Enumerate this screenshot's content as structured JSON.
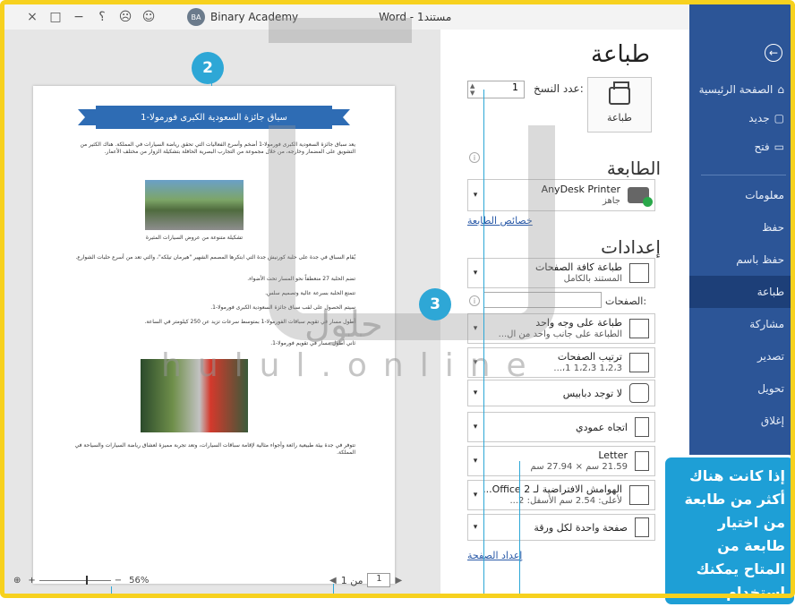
{
  "titlebar": {
    "close": "×",
    "restore": "□",
    "minimize": "−",
    "help": "؟",
    "sad_face": "☹",
    "smile_face": "☺",
    "avatar": "BA",
    "account": "Binary Academy",
    "doc_title": "Word - مستند1"
  },
  "sidebar": {
    "back": "←",
    "items": [
      {
        "label": "الصفحة الرئيسية",
        "icon": "⌂"
      },
      {
        "label": "جديد",
        "icon": "▢"
      },
      {
        "label": "فتح",
        "icon": "▭"
      },
      {
        "label": "معلومات"
      },
      {
        "label": "حفظ"
      },
      {
        "label": "حفظ باسم"
      },
      {
        "label": "طباعة"
      },
      {
        "label": "مشاركة"
      },
      {
        "label": "تصدير"
      },
      {
        "label": "تحويل"
      },
      {
        "label": "إغلاق"
      }
    ]
  },
  "print": {
    "title": "طباعة",
    "copies_label": "عدد النسخ:",
    "copies_value": "1",
    "print_button": "طباعة"
  },
  "printer": {
    "heading": "الطابعة",
    "name": "AnyDesk Printer",
    "status": "جاهز",
    "properties_link": "خصائص الطابعة"
  },
  "settings": {
    "heading": "إعدادات",
    "pages_label": "الصفحات:",
    "options": [
      {
        "line1": "طباعة كافة الصفحات",
        "line2": "المستند بالكامل"
      },
      {
        "line1": "طباعة على وجه واحد",
        "line2": "الطباعة على جانب واحد من ال..."
      },
      {
        "line1": "ترتيب الصفحات",
        "line2": "1،2،3    1،2،3    1،..."
      },
      {
        "line1": "لا توجد دبابيس",
        "line2": ""
      },
      {
        "line1": "اتجاه عمودي",
        "line2": ""
      },
      {
        "line1": "Letter",
        "line2": "21.59 سم × 27.94 سم"
      },
      {
        "line1": "الهوامش الافتراضية لـ Office 2...",
        "line2": "لأعلى: 2.54 سم الأسفل: 2..."
      },
      {
        "line1": "صفحة واحدة لكل ورقة",
        "line2": ""
      }
    ],
    "page_setup_link": "إعداد الصفحة"
  },
  "preview": {
    "banner_title": "سباق جائزة السعودية الكبرى فورمولا-1",
    "para1": "يعد سباق جائزة السعودية الكبرى فورمولا-1 أضخم وأسرع الفعاليات التي تحقق رياضة السيارات في المملكة. هناك الكثير من التشويق على المضمار وخارجه، من خلال مجموعة من التجارب البصرية الحافلة بتشكيلة الزوار من مختلف الأعمار.",
    "caption": "تشكيلة متنوعة من عروض السيارات المثيرة",
    "para2": "يُقام السباق في جدة على حلبة كورنيش جدة التي ابتكرها المصمم الشهير \"هيرمان تيلكه\"، والتي تعد من أسرع حلبات الشوارع.",
    "bullets": [
      "تضم الحلبة 27 منعطفاً نحو المسار تحت الأضواء.",
      "تتمتع الحلبة بسرعة عالية وتصميم سلس.",
      "سيتم الحصول على لقب سباق جائزة السعودية الكبرى فورمولا-1.",
      "أطول مسار في تقويم سباقات الفورمولا-1 بمتوسط سرعات تزيد عن 250 كيلومتر في الساعة.",
      "ثاني أطول مسار في تقويم فورمولا-1."
    ],
    "para3": "تتوفر في جدة بيئة طبيعية رائعة وأجواء مثالية لإقامة سباقات السيارات، وتعد تجربة مميزة لعشاق رياضة السيارات والسياحة في المملكة."
  },
  "statusbar": {
    "zoom_label": "56%",
    "zoom_minus": "−",
    "zoom_plus": "+",
    "page_current": "1",
    "page_of": "من 1"
  },
  "annotations": {
    "badge2": "2",
    "badge3": "3",
    "callout": "إذا كانت هناك أكثر من طابعة من اختيار طابعة من المتاح يمكنك استخدام الطابعة الموصلة مباشرة بالحاسب (الطابعة المحلية) أو الطابعة"
  },
  "watermark": {
    "arabic": "حلول",
    "latin": "hulul.online"
  },
  "colors": {
    "sidebar": "#2c5597",
    "accent_badge": "#2ea7d6",
    "frame": "#f7d11e"
  }
}
